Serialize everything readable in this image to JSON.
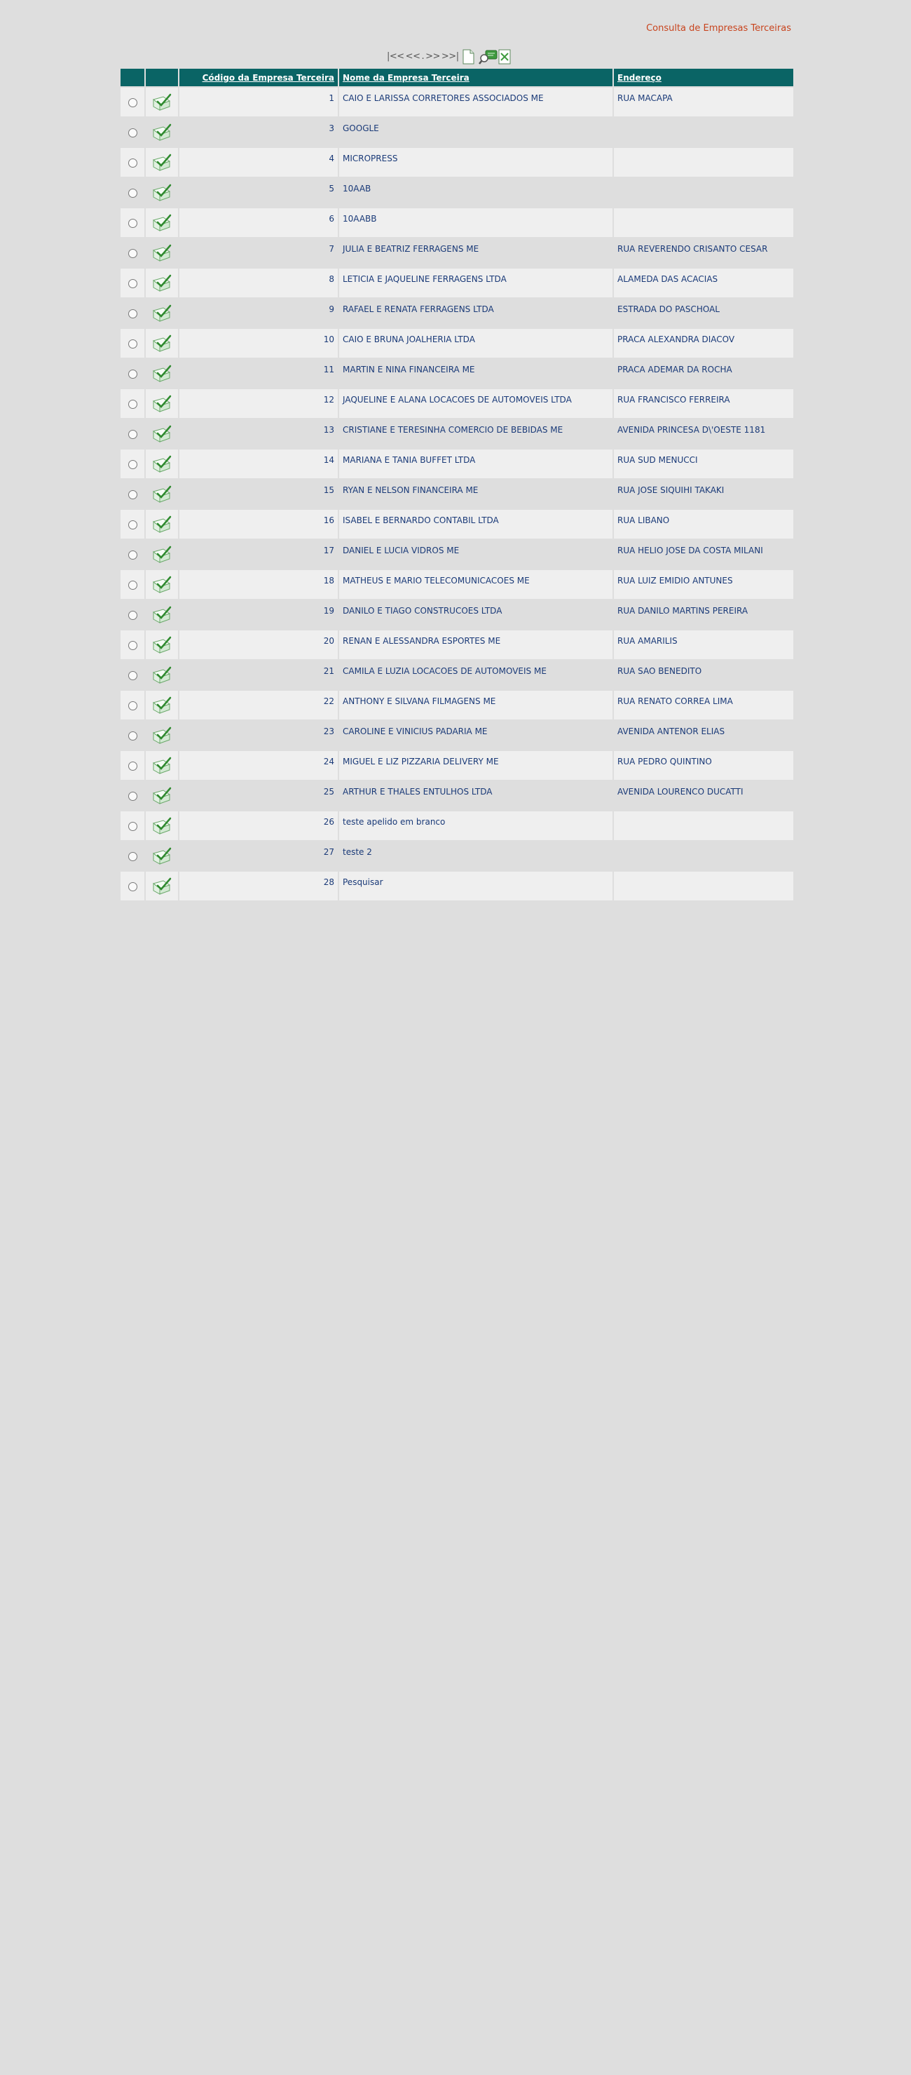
{
  "header": {
    "title": "Consulta de Empresas Terceiras"
  },
  "nav": {
    "first": "|<<",
    "prev": "<<",
    "next": ">>",
    "last": ">>|",
    "icons": [
      "new-document-icon",
      "search-icon",
      "export-icon"
    ]
  },
  "table": {
    "columns": {
      "code": "Código da Empresa Terceira",
      "name": "Nome da Empresa Terceira",
      "address": "Endereço"
    },
    "row_icon": "edit-icon",
    "rows": [
      {
        "code": "1",
        "name": "CAIO E LARISSA CORRETORES ASSOCIADOS ME",
        "address": "RUA MACAPA"
      },
      {
        "code": "3",
        "name": "GOOGLE",
        "address": ""
      },
      {
        "code": "4",
        "name": "MICROPRESS",
        "address": ""
      },
      {
        "code": "5",
        "name": "10AAB",
        "address": ""
      },
      {
        "code": "6",
        "name": "10AABB",
        "address": ""
      },
      {
        "code": "7",
        "name": "JULIA E BEATRIZ FERRAGENS ME",
        "address": "RUA REVERENDO CRISANTO CESAR"
      },
      {
        "code": "8",
        "name": "LETICIA E JAQUELINE FERRAGENS LTDA",
        "address": "ALAMEDA DAS ACACIAS"
      },
      {
        "code": "9",
        "name": "RAFAEL E RENATA FERRAGENS LTDA",
        "address": "ESTRADA DO PASCHOAL"
      },
      {
        "code": "10",
        "name": "CAIO E BRUNA JOALHERIA LTDA",
        "address": "PRACA ALEXANDRA DIACOV"
      },
      {
        "code": "11",
        "name": "MARTIN E NINA FINANCEIRA ME",
        "address": "PRACA ADEMAR DA ROCHA"
      },
      {
        "code": "12",
        "name": "JAQUELINE E ALANA LOCACOES DE AUTOMOVEIS LTDA",
        "address": "RUA FRANCISCO FERREIRA"
      },
      {
        "code": "13",
        "name": "CRISTIANE E TERESINHA COMERCIO DE BEBIDAS ME",
        "address": "AVENIDA PRINCESA D\\'OESTE 1181"
      },
      {
        "code": "14",
        "name": "MARIANA E TANIA BUFFET LTDA",
        "address": "RUA SUD MENUCCI"
      },
      {
        "code": "15",
        "name": "RYAN E NELSON FINANCEIRA ME",
        "address": "RUA JOSE SIQUIHI TAKAKI"
      },
      {
        "code": "16",
        "name": "ISABEL E BERNARDO CONTABIL LTDA",
        "address": "RUA LIBANO"
      },
      {
        "code": "17",
        "name": "DANIEL E LUCIA VIDROS ME",
        "address": "RUA HELIO JOSE DA COSTA MILANI"
      },
      {
        "code": "18",
        "name": "MATHEUS E MARIO TELECOMUNICACOES ME",
        "address": "RUA LUIZ EMIDIO ANTUNES"
      },
      {
        "code": "19",
        "name": "DANILO E TIAGO CONSTRUCOES LTDA",
        "address": "RUA DANILO MARTINS PEREIRA"
      },
      {
        "code": "20",
        "name": "RENAN E ALESSANDRA ESPORTES ME",
        "address": "RUA AMARILIS"
      },
      {
        "code": "21",
        "name": "CAMILA E LUZIA LOCACOES DE AUTOMOVEIS ME",
        "address": "RUA SAO BENEDITO"
      },
      {
        "code": "22",
        "name": "ANTHONY E SILVANA FILMAGENS ME",
        "address": "RUA RENATO CORREA LIMA"
      },
      {
        "code": "23",
        "name": "CAROLINE E VINICIUS PADARIA ME",
        "address": "AVENIDA ANTENOR ELIAS"
      },
      {
        "code": "24",
        "name": "MIGUEL E LIZ PIZZARIA DELIVERY ME",
        "address": "RUA PEDRO QUINTINO"
      },
      {
        "code": "25",
        "name": "ARTHUR E THALES ENTULHOS LTDA",
        "address": "AVENIDA LOURENCO DUCATTI"
      },
      {
        "code": "26",
        "name": "teste apelido em branco",
        "address": ""
      },
      {
        "code": "27",
        "name": "teste 2",
        "address": ""
      },
      {
        "code": "28",
        "name": "Pesquisar",
        "address": ""
      }
    ]
  }
}
